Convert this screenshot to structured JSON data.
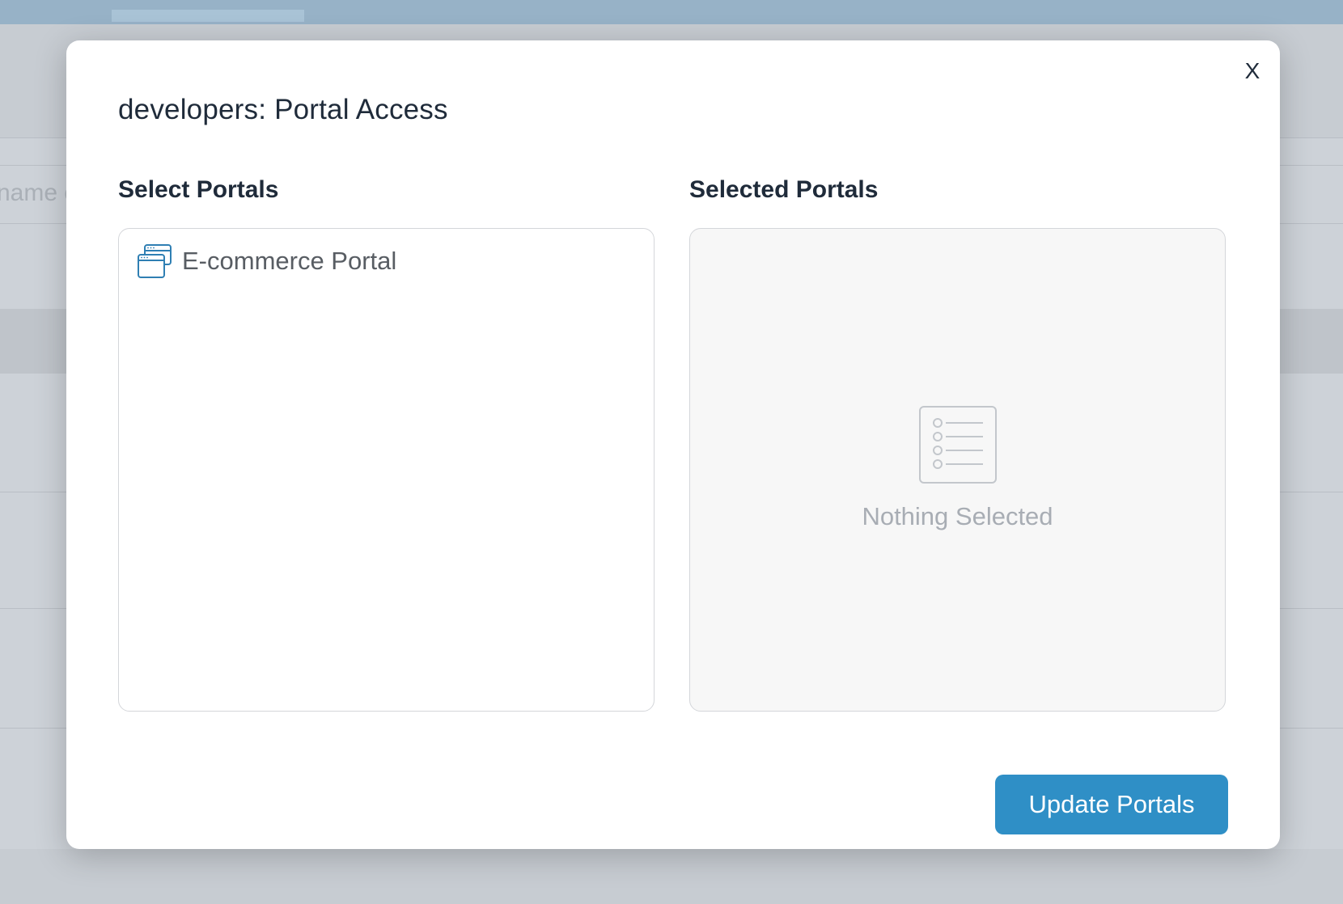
{
  "background": {
    "search_placeholder_fragment": "name o"
  },
  "modal": {
    "title": "developers: Portal Access",
    "close_label": "X",
    "select_portals": {
      "label": "Select Portals",
      "items": [
        {
          "label": "E-commerce Portal",
          "icon": "browser-windows-icon"
        }
      ]
    },
    "selected_portals": {
      "label": "Selected Portals",
      "empty_text": "Nothing Selected",
      "empty_icon": "list-icon"
    },
    "update_button_label": "Update Portals"
  },
  "colors": {
    "accent": "#2f8fc6",
    "title_text": "#1f2b3a",
    "muted_text": "#a8adb4",
    "overlay_bg": "#cdd2d8"
  }
}
